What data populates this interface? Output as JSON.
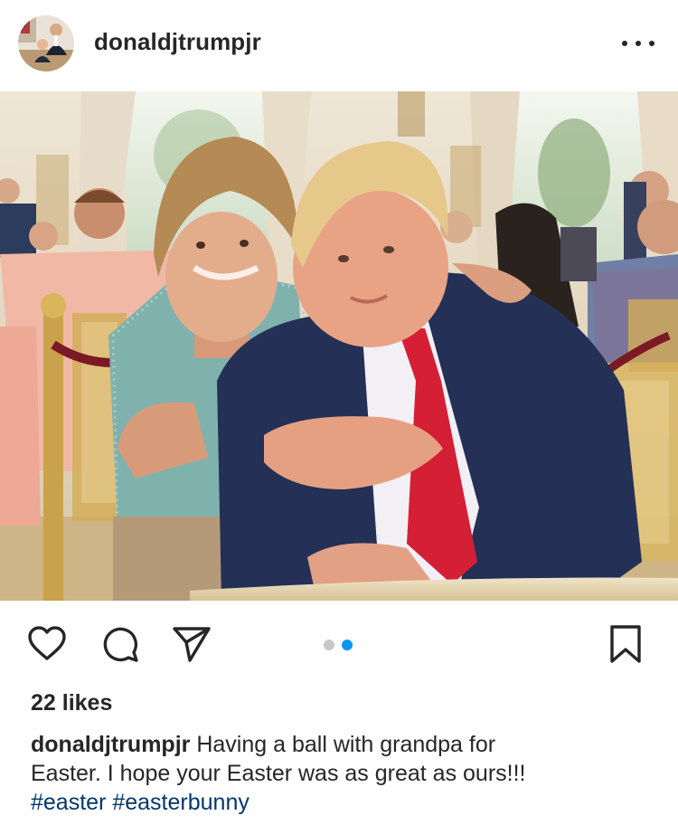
{
  "post": {
    "username": "donaldjtrumpjr",
    "likes": "22 likes",
    "caption_user": "donaldjtrumpjr",
    "caption_line1": " Having a ball with grandpa for",
    "caption_line2": "Easter. I hope your Easter was as great as ours!!!",
    "hashtags": [
      "#easter",
      "#easterbunny"
    ],
    "carousel": {
      "count": 2,
      "active_index": 1
    }
  },
  "icons": {
    "more": "more-options-icon",
    "like": "heart-icon",
    "comment": "comment-icon",
    "share": "paper-plane-icon",
    "save": "bookmark-icon"
  },
  "colors": {
    "text": "#262626",
    "hashtag": "#00376b",
    "dot_active": "#0095f6",
    "dot_inactive": "#c7c7c7"
  }
}
